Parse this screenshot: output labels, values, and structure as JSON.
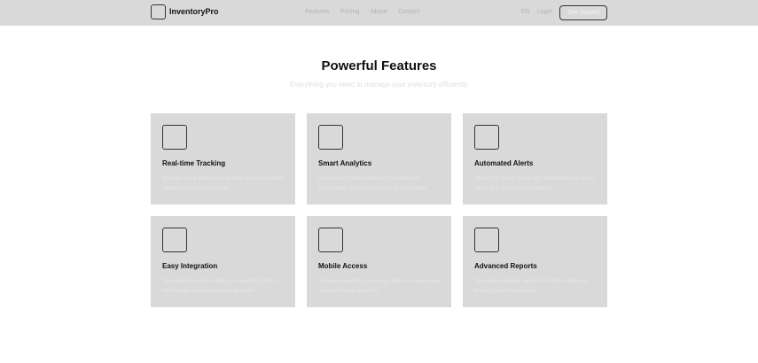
{
  "header": {
    "brand": "InventoryPro",
    "nav": [
      "Features",
      "Pricing",
      "About",
      "Contact"
    ],
    "lang": "EN",
    "login": "Login",
    "cta": "Get Started"
  },
  "hero": {
    "title": "Powerful Features",
    "subtitle": "Everything you need to manage  your inventory efficiently"
  },
  "features": [
    {
      "title": "Real-time Tracking",
      "desc": "Monitor stock levels in real-time across multiple locations and warehouses."
    },
    {
      "title": "Smart Analytics",
      "desc": "Get insights into inventory rms, demand forecasting, and optimization opportunities."
    },
    {
      "title": "Automated Alerts",
      "desc": "Never run out of stock with intelligent low stock alerts and reorder notifications."
    },
    {
      "title": "Easy Integration",
      "desc": "Seamlessly connect with your existing ERP, e-commerce, and accounting systems."
    },
    {
      "title": "Mobile Access",
      "desc": "Manage inventory on-the-go with our responsive mobile-friendly interface."
    },
    {
      "title": "Advanced Reports",
      "desc": "Generate detailed reports for better decision-making and compliance."
    }
  ]
}
